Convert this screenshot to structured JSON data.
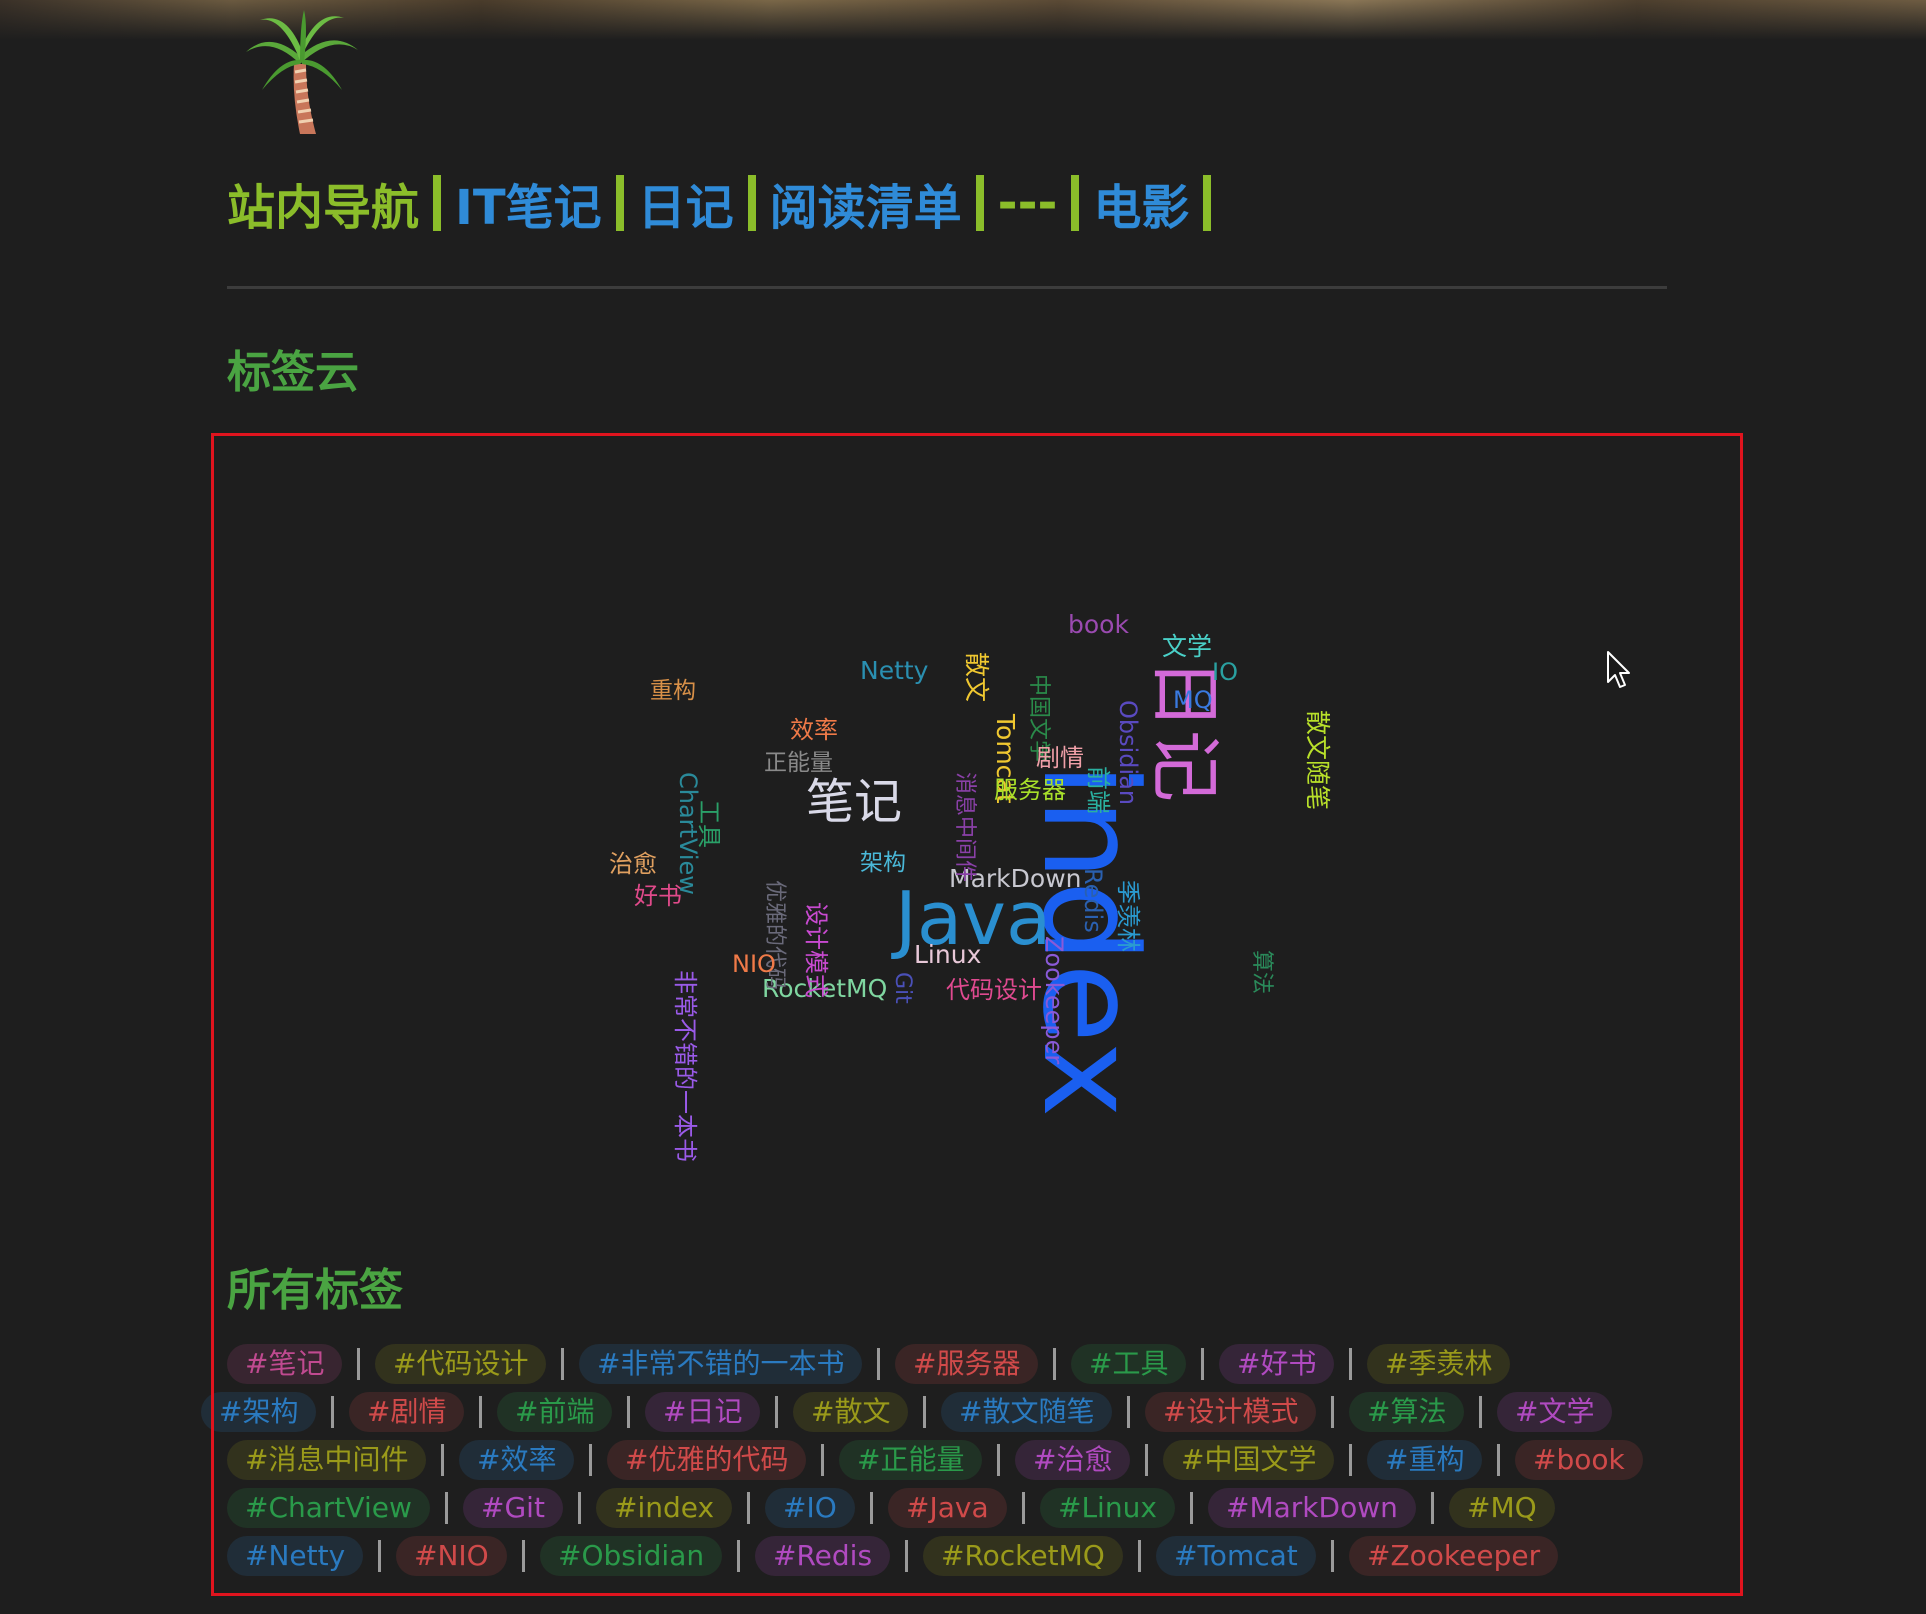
{
  "nav": {
    "home": "站内导航",
    "it_notes": "IT笔记",
    "diary": "日记",
    "reading_list": "阅读清单",
    "dashes": "---",
    "movies": "电影"
  },
  "headings": {
    "tag_cloud": "标签云",
    "all_tags": "所有标签"
  },
  "cloud_words": [
    {
      "text": "index",
      "color": "#1a5ff0"
    },
    {
      "text": "日记",
      "color": "#d36ad8"
    },
    {
      "text": "Java",
      "color": "#2a8fd0"
    },
    {
      "text": "笔记",
      "color": "#d9d9e8"
    },
    {
      "text": "MarkDown",
      "color": "#c8c8d0"
    },
    {
      "text": "Linux",
      "color": "#e8c8d8"
    },
    {
      "text": "RocketMQ",
      "color": "#7fd6a0"
    },
    {
      "text": "Netty",
      "color": "#2a8fb0"
    },
    {
      "text": "book",
      "color": "#9a4ab0"
    },
    {
      "text": "文学",
      "color": "#4ad0c8"
    },
    {
      "text": "IO",
      "color": "#2aa0a0"
    },
    {
      "text": "MQ",
      "color": "#3a7ae0"
    },
    {
      "text": "散文随笔",
      "color": "#b8e02a"
    },
    {
      "text": "散文",
      "color": "#f0c830"
    },
    {
      "text": "中国文学",
      "color": "#2a8a4a"
    },
    {
      "text": "Obsidian",
      "color": "#5a4ac0"
    },
    {
      "text": "Tomcat",
      "color": "#f0c830"
    },
    {
      "text": "消息中间件",
      "color": "#8a40a8"
    },
    {
      "text": "剧情",
      "color": "#f0a0a8"
    },
    {
      "text": "服务器",
      "color": "#a8e02a"
    },
    {
      "text": "前端",
      "color": "#2ab0a0"
    },
    {
      "text": "Redis",
      "color": "#2a60b0"
    },
    {
      "text": "季羡林",
      "color": "#2a9ad0"
    },
    {
      "text": "Zookeeper",
      "color": "#8a5ad8"
    },
    {
      "text": "算法",
      "color": "#2a8a5a"
    },
    {
      "text": "重构",
      "color": "#d89048"
    },
    {
      "text": "效率",
      "color": "#f07a48"
    },
    {
      "text": "正能量",
      "color": "#8a8a8a"
    },
    {
      "text": "ChartView",
      "color": "#2a8a9a"
    },
    {
      "text": "工具",
      "color": "#2aa068"
    },
    {
      "text": "优雅的代码",
      "color": "#6a6a7a"
    },
    {
      "text": "设计模式",
      "color": "#c84ad0"
    },
    {
      "text": "架构",
      "color": "#4ab8d8"
    },
    {
      "text": "治愈",
      "color": "#e0a060"
    },
    {
      "text": "好书",
      "color": "#e04a8a"
    },
    {
      "text": "非常不错的一本书",
      "color": "#9a5ae8"
    },
    {
      "text": "NIO",
      "color": "#f07a48"
    },
    {
      "text": "Git",
      "color": "#4a50b8"
    },
    {
      "text": "代码设计",
      "color": "#e04a90"
    }
  ],
  "all_tags": [
    {
      "label": "#笔记",
      "color": "#c04a90"
    },
    {
      "label": "#代码设计",
      "color": "#9a9a1a"
    },
    {
      "label": "#非常不错的一本书",
      "color": "#2a7ac0"
    },
    {
      "label": "#服务器",
      "color": "#d04a4a"
    },
    {
      "label": "#工具",
      "color": "#2a9a4a"
    },
    {
      "label": "#好书",
      "color": "#b04ac0"
    },
    {
      "label": "#季羡林",
      "color": "#9a9a1a"
    },
    {
      "label": "#架构",
      "color": "#2a7ac0"
    },
    {
      "label": "#剧情",
      "color": "#d04a4a"
    },
    {
      "label": "#前端",
      "color": "#2a9a4a"
    },
    {
      "label": "#日记",
      "color": "#b04ac0"
    },
    {
      "label": "#散文",
      "color": "#9a9a1a"
    },
    {
      "label": "#散文随笔",
      "color": "#2a7ac0"
    },
    {
      "label": "#设计模式",
      "color": "#d04a4a"
    },
    {
      "label": "#算法",
      "color": "#2a9a4a"
    },
    {
      "label": "#文学",
      "color": "#b04ac0"
    },
    {
      "label": "#消息中间件",
      "color": "#9a9a1a"
    },
    {
      "label": "#效率",
      "color": "#2a7ac0"
    },
    {
      "label": "#优雅的代码",
      "color": "#d04a4a"
    },
    {
      "label": "#正能量",
      "color": "#2a9a4a"
    },
    {
      "label": "#治愈",
      "color": "#b04ac0"
    },
    {
      "label": "#中国文学",
      "color": "#9a9a1a"
    },
    {
      "label": "#重构",
      "color": "#2a7ac0"
    },
    {
      "label": "#book",
      "color": "#d04a4a"
    },
    {
      "label": "#ChartView",
      "color": "#2a9a4a"
    },
    {
      "label": "#Git",
      "color": "#b04ac0"
    },
    {
      "label": "#index",
      "color": "#9a9a1a"
    },
    {
      "label": "#IO",
      "color": "#2a7ac0"
    },
    {
      "label": "#Java",
      "color": "#d04a4a"
    },
    {
      "label": "#Linux",
      "color": "#2a9a4a"
    },
    {
      "label": "#MarkDown",
      "color": "#b04ac0"
    },
    {
      "label": "#MQ",
      "color": "#9a9a1a"
    },
    {
      "label": "#Netty",
      "color": "#2a7ac0"
    },
    {
      "label": "#NIO",
      "color": "#d04a4a"
    },
    {
      "label": "#Obsidian",
      "color": "#2a9a4a"
    },
    {
      "label": "#Redis",
      "color": "#b04ac0"
    },
    {
      "label": "#RocketMQ",
      "color": "#9a9a1a"
    },
    {
      "label": "#Tomcat",
      "color": "#2a7ac0"
    },
    {
      "label": "#Zookeeper",
      "color": "#d04a4a"
    }
  ],
  "icons": {
    "logo": "palm-tree-icon",
    "cursor": "mouse-pointer-icon"
  }
}
